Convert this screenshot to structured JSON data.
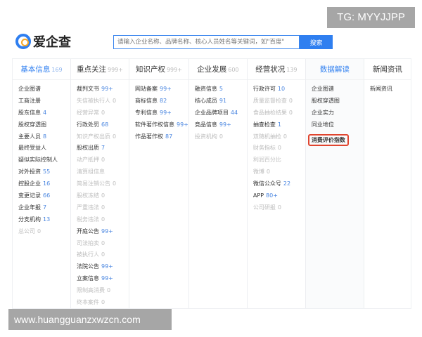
{
  "watermark_top": "TG: MYYJJPP",
  "watermark_bottom": "www.huangguanzxwzcn.com",
  "logo": "爱企查",
  "search": {
    "placeholder": "请输入企业名称、品牌名称、核心人员姓名等关键词，如\"百度\"",
    "button": "搜索"
  },
  "columns": [
    {
      "title": "基本信息",
      "count": "169",
      "active": true,
      "items": [
        {
          "label": "企业图谱"
        },
        {
          "label": "工商注册"
        },
        {
          "label": "股东信息",
          "count": "4"
        },
        {
          "label": "股权穿透图"
        },
        {
          "label": "主要人员",
          "count": "8"
        },
        {
          "label": "最终受益人"
        },
        {
          "label": "疑似实际控制人"
        },
        {
          "label": "对外投资",
          "count": "55"
        },
        {
          "label": "控股企业",
          "count": "16"
        },
        {
          "label": "变更记录",
          "count": "66"
        },
        {
          "label": "企业年报",
          "count": "7"
        },
        {
          "label": "分支机构",
          "count": "13"
        },
        {
          "label": "总公司",
          "count": "0",
          "disabled": true
        }
      ]
    },
    {
      "title": "重点关注",
      "count": "999+",
      "items": [
        {
          "label": "裁判文书",
          "count": "99+"
        },
        {
          "label": "失信被执行人",
          "count": "0",
          "disabled": true
        },
        {
          "label": "经营异常",
          "count": "0",
          "disabled": true
        },
        {
          "label": "行政处罚",
          "count": "68"
        },
        {
          "label": "知识产权出质",
          "count": "0",
          "disabled": true
        },
        {
          "label": "股权出质",
          "count": "7"
        },
        {
          "label": "动产抵押",
          "count": "0",
          "disabled": true
        },
        {
          "label": "清算组信息",
          "disabled": true
        },
        {
          "label": "简易注销公告",
          "count": "0",
          "disabled": true
        },
        {
          "label": "股权冻结",
          "count": "0",
          "disabled": true
        },
        {
          "label": "严重违法",
          "count": "0",
          "disabled": true
        },
        {
          "label": "税务违法",
          "count": "0",
          "disabled": true
        },
        {
          "label": "开庭公告",
          "count": "99+"
        },
        {
          "label": "司法拍卖",
          "count": "0",
          "disabled": true
        },
        {
          "label": "被执行人",
          "count": "0",
          "disabled": true
        },
        {
          "label": "法院公告",
          "count": "99+"
        },
        {
          "label": "立案信息",
          "count": "99+"
        },
        {
          "label": "限制高消费",
          "count": "0",
          "disabled": true
        },
        {
          "label": "终本案件",
          "count": "0",
          "disabled": true
        }
      ]
    },
    {
      "title": "知识产权",
      "count": "999+",
      "items": [
        {
          "label": "网站备案",
          "count": "99+"
        },
        {
          "label": "商标信息",
          "count": "82"
        },
        {
          "label": "专利信息",
          "count": "99+"
        },
        {
          "label": "软件著作权信息",
          "count": "99+"
        },
        {
          "label": "作品著作权",
          "count": "87"
        }
      ]
    },
    {
      "title": "企业发展",
      "count": "600",
      "items": [
        {
          "label": "融资信息",
          "count": "5"
        },
        {
          "label": "核心成员",
          "count": "91"
        },
        {
          "label": "企业品牌项目",
          "count": "44"
        },
        {
          "label": "竞品信息",
          "count": "99+"
        },
        {
          "label": "投资机构",
          "count": "0",
          "disabled": true
        }
      ]
    },
    {
      "title": "经营状况",
      "count": "139",
      "items": [
        {
          "label": "行政许可",
          "count": "10"
        },
        {
          "label": "质量监督检查",
          "count": "0",
          "disabled": true
        },
        {
          "label": "食品抽检结果",
          "count": "0",
          "disabled": true
        },
        {
          "label": "抽查检查",
          "count": "1"
        },
        {
          "label": "双随机抽检",
          "count": "0",
          "disabled": true
        },
        {
          "label": "财务指标",
          "count": "0",
          "disabled": true
        },
        {
          "label": "利润百分比",
          "disabled": true
        },
        {
          "label": "微博",
          "count": "0",
          "disabled": true
        },
        {
          "label": "微信公众号",
          "count": "22"
        },
        {
          "label": "APP",
          "count": "80+"
        },
        {
          "label": "公司研报",
          "count": "0",
          "disabled": true
        }
      ]
    },
    {
      "title": "数据解读",
      "highlight_title": true,
      "items": [
        {
          "label": "企业图谱"
        },
        {
          "label": "股权穿透图"
        },
        {
          "label": "企业实力"
        },
        {
          "label": "同业地位"
        },
        {
          "label": "消费评价指数",
          "highlighted": true
        }
      ]
    },
    {
      "title": "新闻资讯",
      "items": [
        {
          "label": "新闻资讯"
        }
      ]
    }
  ],
  "colors": {
    "accent": "#2f7ff0",
    "highlight_border": "#e0452f"
  }
}
